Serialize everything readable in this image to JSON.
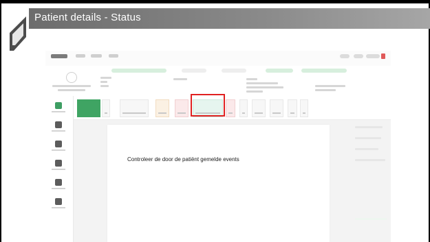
{
  "slide": {
    "title": "Patient details - Status"
  },
  "screenshot": {
    "instruction_text": "Controleer de door de patiënt gemelde events",
    "highlight_color": "#e02020",
    "accent_green": "#3fa463"
  }
}
